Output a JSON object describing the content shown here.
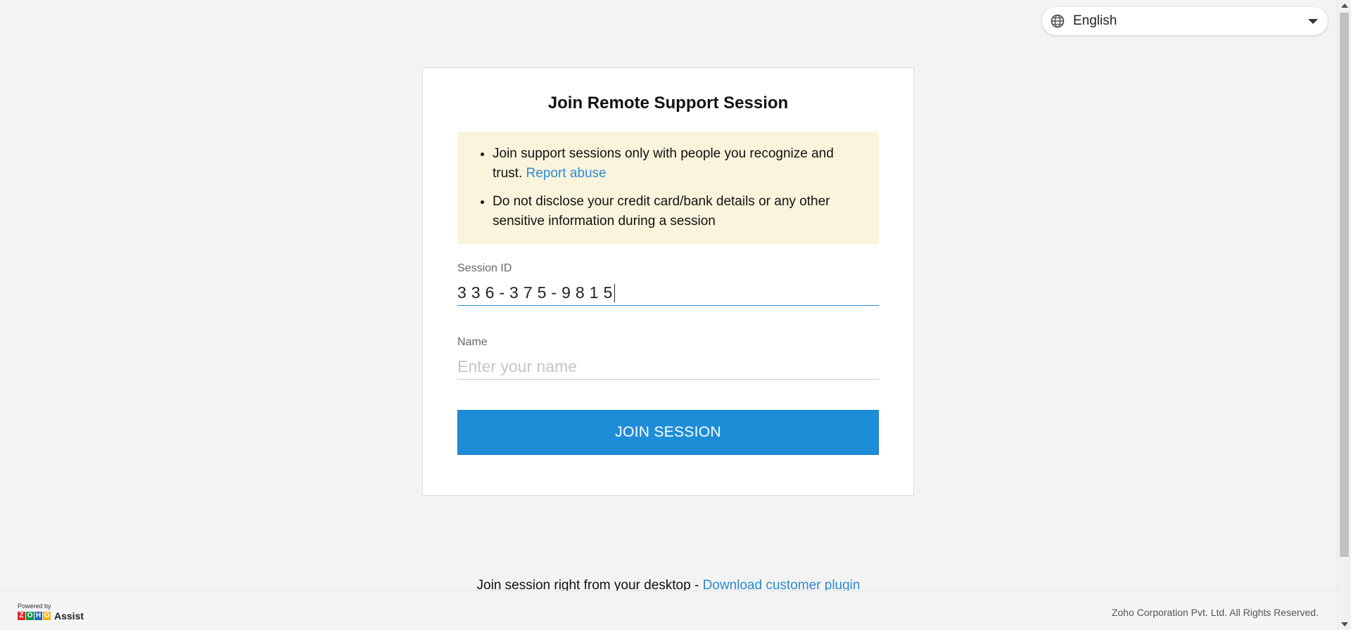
{
  "language": {
    "selected": "English",
    "icon": "globe-icon"
  },
  "card": {
    "title": "Join Remote Support Session",
    "notice": {
      "item1_text": "Join support sessions only with people you recognize and trust.",
      "item1_link": "Report abuse",
      "item2_text": "Do not disclose your credit card/bank details or any other sensitive information during a session"
    },
    "session_id": {
      "label": "Session ID",
      "value": "336-375-9815"
    },
    "name": {
      "label": "Name",
      "placeholder": "Enter your name",
      "value": ""
    },
    "join_button": "JOIN SESSION"
  },
  "desktop": {
    "text": "Join session right from your desktop - ",
    "link": "Download customer plugin"
  },
  "footer": {
    "powered_by": "Powered by",
    "brand_letters": [
      "Z",
      "O",
      "H",
      "O"
    ],
    "product": "Assist",
    "copyright": "Zoho Corporation Pvt. Ltd. All Rights Reserved."
  },
  "colors": {
    "accent": "#1e8dd8",
    "link": "#2d8ad6",
    "notice_bg": "#fbf4dc"
  }
}
